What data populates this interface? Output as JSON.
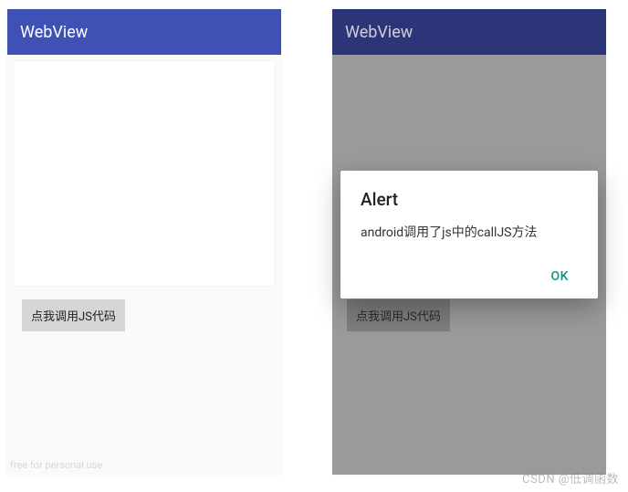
{
  "left": {
    "appbar_title": "WebView",
    "button_label": "点我调用JS代码",
    "footer_note": "free for personal use"
  },
  "right": {
    "appbar_title": "WebView",
    "button_label": "点我调用JS代码",
    "dialog": {
      "title": "Alert",
      "message": "android调用了js中的callJS方法",
      "ok_label": "OK"
    }
  },
  "watermark": "CSDN @低调函数"
}
